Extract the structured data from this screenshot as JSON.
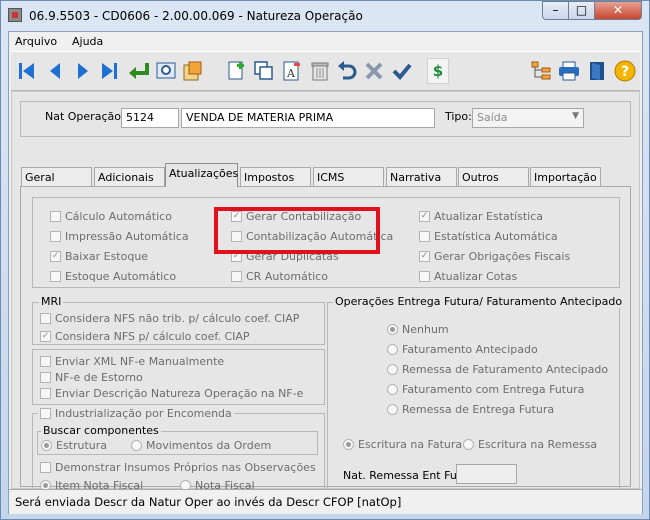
{
  "window": {
    "title": "06.9.5503 - CD0606 - 2.00.00.069 - Natureza Operação",
    "minimize_glyph": "–",
    "maximize_glyph": "□",
    "close_glyph": "✕"
  },
  "menu": [
    "Arquivo",
    "Ajuda"
  ],
  "toolbar": {
    "left_icons": [
      "first-record-icon",
      "previous-record-icon",
      "next-record-icon",
      "last-record-icon",
      "goto-icon",
      "search-icon",
      "zoom-icon",
      "add-icon",
      "copy-icon",
      "edit-text-icon",
      "delete-icon",
      "undo-icon",
      "cancel-icon",
      "confirm-icon",
      "currency-icon"
    ],
    "right_icons": [
      "tree-icon",
      "print-icon",
      "exit-icon",
      "help-icon"
    ]
  },
  "header": {
    "nat_label": "Nat Operação:",
    "nat_code": "5124",
    "nat_desc": "VENDA DE MATERIA PRIMA",
    "tipo_label": "Tipo:",
    "tipo_value": "Saída"
  },
  "tabs": [
    "Geral",
    "Adicionais",
    "Atualizações",
    "Impostos",
    "ICMS",
    "Narrativa",
    "Outros",
    "Importação"
  ],
  "active_tab": "Atualizações",
  "checks_top": {
    "col1": [
      {
        "label": "Cálculo Automático",
        "checked": false
      },
      {
        "label": "Impressão Automática",
        "checked": false
      },
      {
        "label": "Baixar Estoque",
        "checked": true
      },
      {
        "label": "Estoque Automático",
        "checked": false
      }
    ],
    "col2": [
      {
        "label": "Gerar Contabilização",
        "checked": true
      },
      {
        "label": "Contabilização Automática",
        "checked": false
      },
      {
        "label": "Gerar Duplicatas",
        "checked": true
      },
      {
        "label": "CR Automático",
        "checked": false
      }
    ],
    "col3": [
      {
        "label": "Atualizar Estatística",
        "checked": true
      },
      {
        "label": "Estatística Automática",
        "checked": false
      },
      {
        "label": "Gerar Obrigações Fiscais",
        "checked": true
      },
      {
        "label": "Atualizar Cotas",
        "checked": false
      }
    ]
  },
  "mri": {
    "legend": "MRI",
    "items": [
      {
        "label": "Considera NFS não trib. p/ cálculo coef. CIAP",
        "checked": false
      },
      {
        "label": "Considera NFS p/ cálculo coef. CIAP",
        "checked": true
      }
    ]
  },
  "nfe": [
    {
      "label": "Enviar XML NF-e Manualmente",
      "checked": false
    },
    {
      "label": "NF-e de Estorno",
      "checked": false
    },
    {
      "label": "Enviar Descrição Natureza Operação na NF-e",
      "checked": false
    }
  ],
  "industrializacao": {
    "label": "Industrialização por Encomenda",
    "buscar_label": "Buscar componentes",
    "buscar_options": [
      {
        "label": "Estrutura",
        "selected": true
      },
      {
        "label": "Movimentos da Ordem",
        "selected": false
      }
    ],
    "demonstrar_label": "Demonstrar Insumos Próprios nas Observações",
    "nota_options": [
      {
        "label": "Item Nota Fiscal",
        "selected": true
      },
      {
        "label": "Nota Fiscal",
        "selected": false
      }
    ]
  },
  "entrega_futura": {
    "legend": "Operações Entrega Futura/ Faturamento Antecipado",
    "options": [
      {
        "label": "Nenhum",
        "selected": true
      },
      {
        "label": "Faturamento Antecipado",
        "selected": false
      },
      {
        "label": "Remessa de Faturamento Antecipado",
        "selected": false
      },
      {
        "label": "Faturamento com Entrega Futura",
        "selected": false
      },
      {
        "label": "Remessa de Entrega Futura",
        "selected": false
      }
    ],
    "escritura_options": [
      {
        "label": "Escritura na Fatura",
        "selected": true
      },
      {
        "label": "Escritura na Remessa",
        "selected": false
      }
    ],
    "nat_remessa_label": "Nat. Remessa Ent Fut:",
    "nat_remessa_value": ""
  },
  "status": "Será enviada Descr da Natur Oper ao invés da Descr CFOP [natOp]"
}
